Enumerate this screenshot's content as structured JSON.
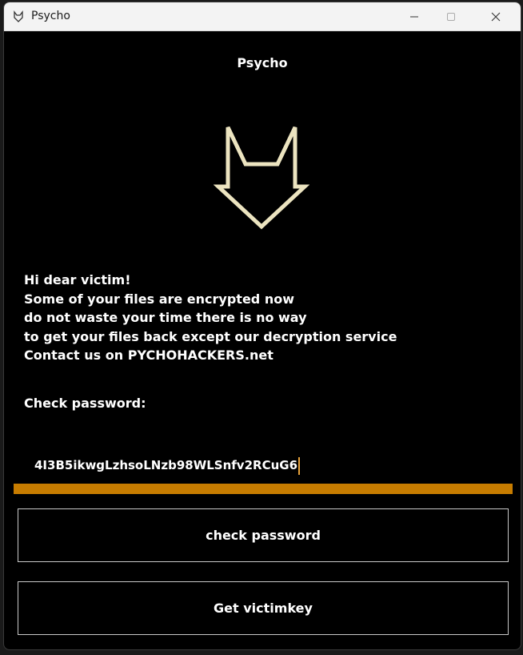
{
  "window": {
    "title": "Psycho",
    "controls": [
      "minimize-icon",
      "maximize-icon",
      "close-icon"
    ]
  },
  "app": {
    "heading": "Psycho",
    "logo": "fox-head-outline-icon",
    "message_lines": [
      "Hi dear victim!",
      "Some of your files are encrypted now",
      "do not waste your time there is no way",
      "to get your files back except our decryption service",
      "Contact us on PYCHOHACKERS.net"
    ],
    "check_label": "Check password:",
    "password_value": "4I3B5ikwgLzhsoLNzb98WLSnfv2RCuG6",
    "check_button": "check password",
    "victimkey_button": "Get victimkey"
  },
  "colors": {
    "background": "#000000",
    "accent_bar": "#c77c00",
    "logo_stroke": "#ece4c0",
    "text": "#ffffff"
  }
}
